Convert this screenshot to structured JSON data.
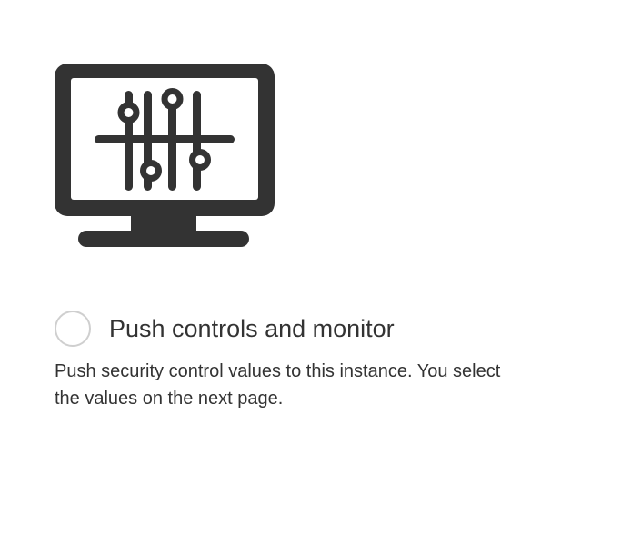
{
  "illustration": {
    "icon": "monitor-sliders-icon",
    "color": "#333333"
  },
  "option": {
    "title": "Push controls and monitor",
    "description": "Push security control values to this instance. You select the values on the next page.",
    "selected": false,
    "radio_border_color": "#cfcfcf"
  }
}
